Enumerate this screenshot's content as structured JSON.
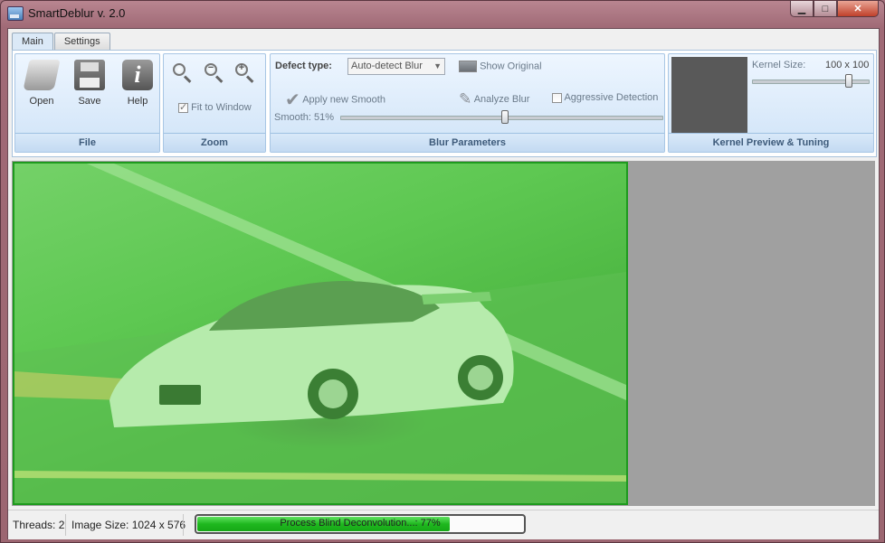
{
  "window": {
    "title": "SmartDeblur v. 2.0",
    "icon": "app-icon",
    "controls": {
      "minimize": "▁",
      "maximize": "□",
      "close": "✕"
    }
  },
  "tabs": [
    {
      "label": "Main",
      "active": true
    },
    {
      "label": "Settings",
      "active": false
    }
  ],
  "ribbon": {
    "file": {
      "label": "File",
      "open": "Open",
      "save": "Save",
      "help": "Help",
      "help_glyph": "i"
    },
    "zoom": {
      "label": "Zoom",
      "zoom_in_symbol": "+",
      "zoom_out_symbol": "−",
      "fit_to_window": "Fit to Window",
      "fit_checked": true
    },
    "blur": {
      "label": "Blur Parameters",
      "defect_label": "Defect type:",
      "defect_value": "Auto-detect Blur",
      "show_original": "Show Original",
      "apply_smooth": "Apply new Smooth",
      "analyze_blur": "Analyze Blur",
      "aggressive": "Aggressive Detection",
      "aggressive_checked": false,
      "smooth_label": "Smooth:",
      "smooth_value": "51%",
      "smooth_level": 0.51
    },
    "kernel": {
      "label": "Kernel Preview & Tuning",
      "size_label": "Kernel Size:",
      "size_value": "100 x 100",
      "slider_level": 0.82
    }
  },
  "viewer": {
    "photo_description": "car-on-racetrack-image",
    "overlay_color": "#5ec852"
  },
  "status": {
    "threads": "Threads: 2",
    "image_size": "Image Size: 1024 x 576",
    "progress_text": "Process Blind Deconvolution...: 77%",
    "progress_level": 0.77
  }
}
